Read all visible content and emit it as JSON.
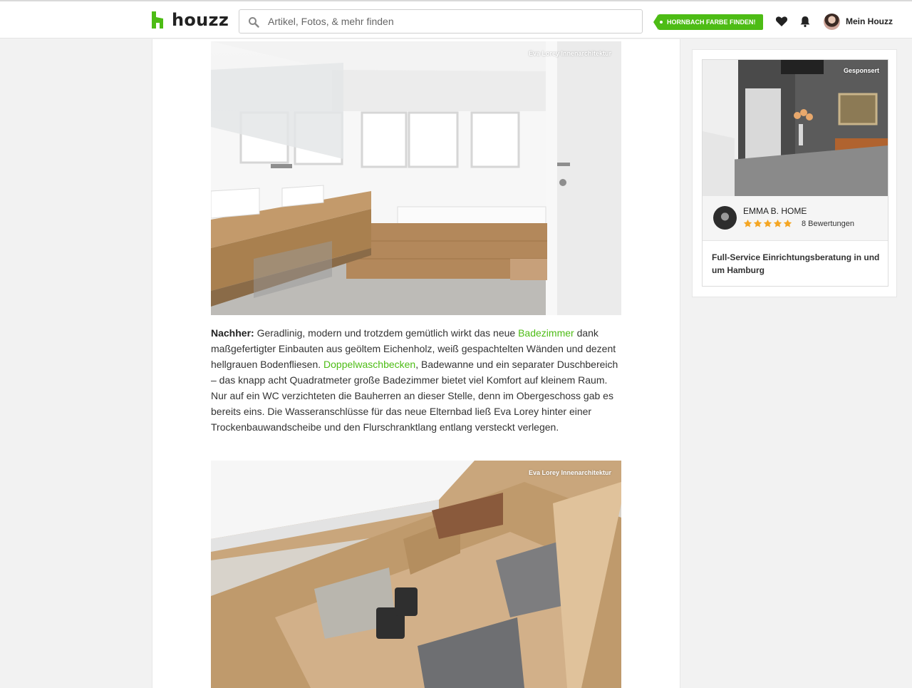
{
  "header": {
    "logo_text": "houzz",
    "search": {
      "placeholder": "Artikel, Fotos, & mehr finden"
    },
    "promo_label": "HORNBACH FARBE FINDEN!",
    "account_label": "Mein Houzz"
  },
  "article": {
    "photos": [
      {
        "credit": "Eva Lorey Innenarchitektur"
      },
      {
        "credit": "Eva Lorey Innenarchitektur"
      }
    ],
    "paragraph": {
      "lead": "Nachher:",
      "part1": " Geradlinig, modern und trotzdem gemütlich wirkt das neue ",
      "link1": "Badezimmer",
      "part2": " dank maßgefertigter Einbauten aus geöltem Eichenholz, weiß gespachtelten Wänden und dezent hellgrauen Bodenfliesen. ",
      "link2": "Doppelwaschbecken",
      "part3": ", Badewanne und ein separater Duschbereich – das knapp acht Quadratmeter große Badezimmer bietet viel Komfort auf kleinem Raum. Nur auf ein WC verzichteten die Bauherren an dieser Stelle, denn im Obergeschoss gab es bereits eins. Die Wasseranschlüsse für das neue Elternbad ließ Eva Lorey hinter einer Trockenbauwandscheibe und den Flurschranktlang entlang versteckt verlegen."
    }
  },
  "sidebar": {
    "ad": {
      "sponsored_label": "Gesponsert",
      "pro_name": "EMMA B. HOME",
      "rating": 5,
      "reviews": "8 Bewertungen",
      "description": "Full-Service Einrichtungsberatung in und um Hamburg"
    }
  },
  "colors": {
    "brand_green": "#4dbc15",
    "star": "#f5a623"
  }
}
